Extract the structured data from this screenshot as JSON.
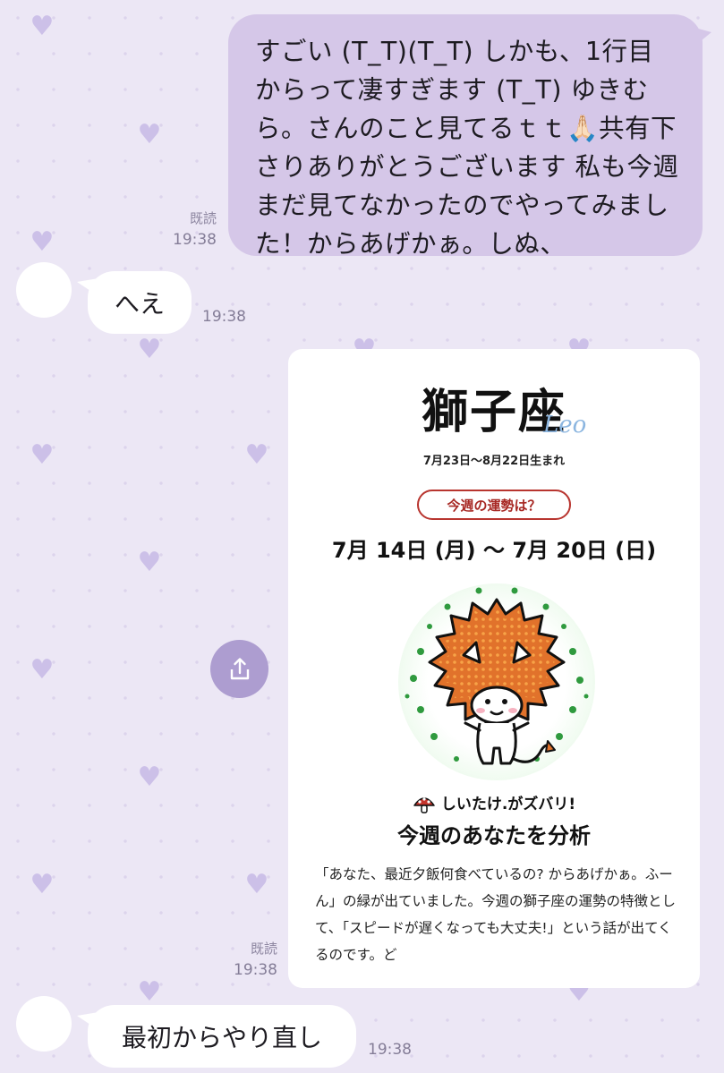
{
  "chat": {
    "outgoing_message": {
      "text": "すごい (T_T)(T_T) しかも、1行目からって凄すぎます (T_T) ゆきむら。さんのこと見てるｔｔ🙏🏻共有下さりありがとうございます 私も今週まだ見てなかったのでやってみました！からあげかぁ。しぬ、",
      "read_label": "既読",
      "time": "19:38"
    },
    "incoming_reply_1": {
      "text": "へえ",
      "time": "19:38"
    },
    "shared_card": {
      "read_label": "既読",
      "time": "19:38",
      "title": "獅子座",
      "title_latin": "Leo",
      "birth_range": "7月23日〜8月22日生まれ",
      "pill_label": "今週の運勢は？",
      "week_range": "7月 14日 (月) 〜 7月 20日 (日)",
      "tagline": "しいたけ.がズバリ!",
      "heading": "今週のあなたを分析",
      "body": "「あなた、最近夕飯何食べているの? からあげかぁ。ふーん」の緑が出ていました。今週の獅子座の運勢の特徴として、「スピードが遅くなっても大丈夫!」という話が出てくるのです。ど"
    },
    "incoming_reply_2": {
      "text": "最初からやり直し",
      "time": "19:38"
    },
    "share_icon": "share-icon",
    "background_heart_icon": "heart-icon"
  },
  "colors": {
    "background": "#ece7f5",
    "outgoing_bubble": "#d5c7e8",
    "incoming_bubble": "#ffffff",
    "share_button": "#ad9dd0",
    "pill_border": "#b8352f",
    "heart": "#ccc0e8"
  }
}
